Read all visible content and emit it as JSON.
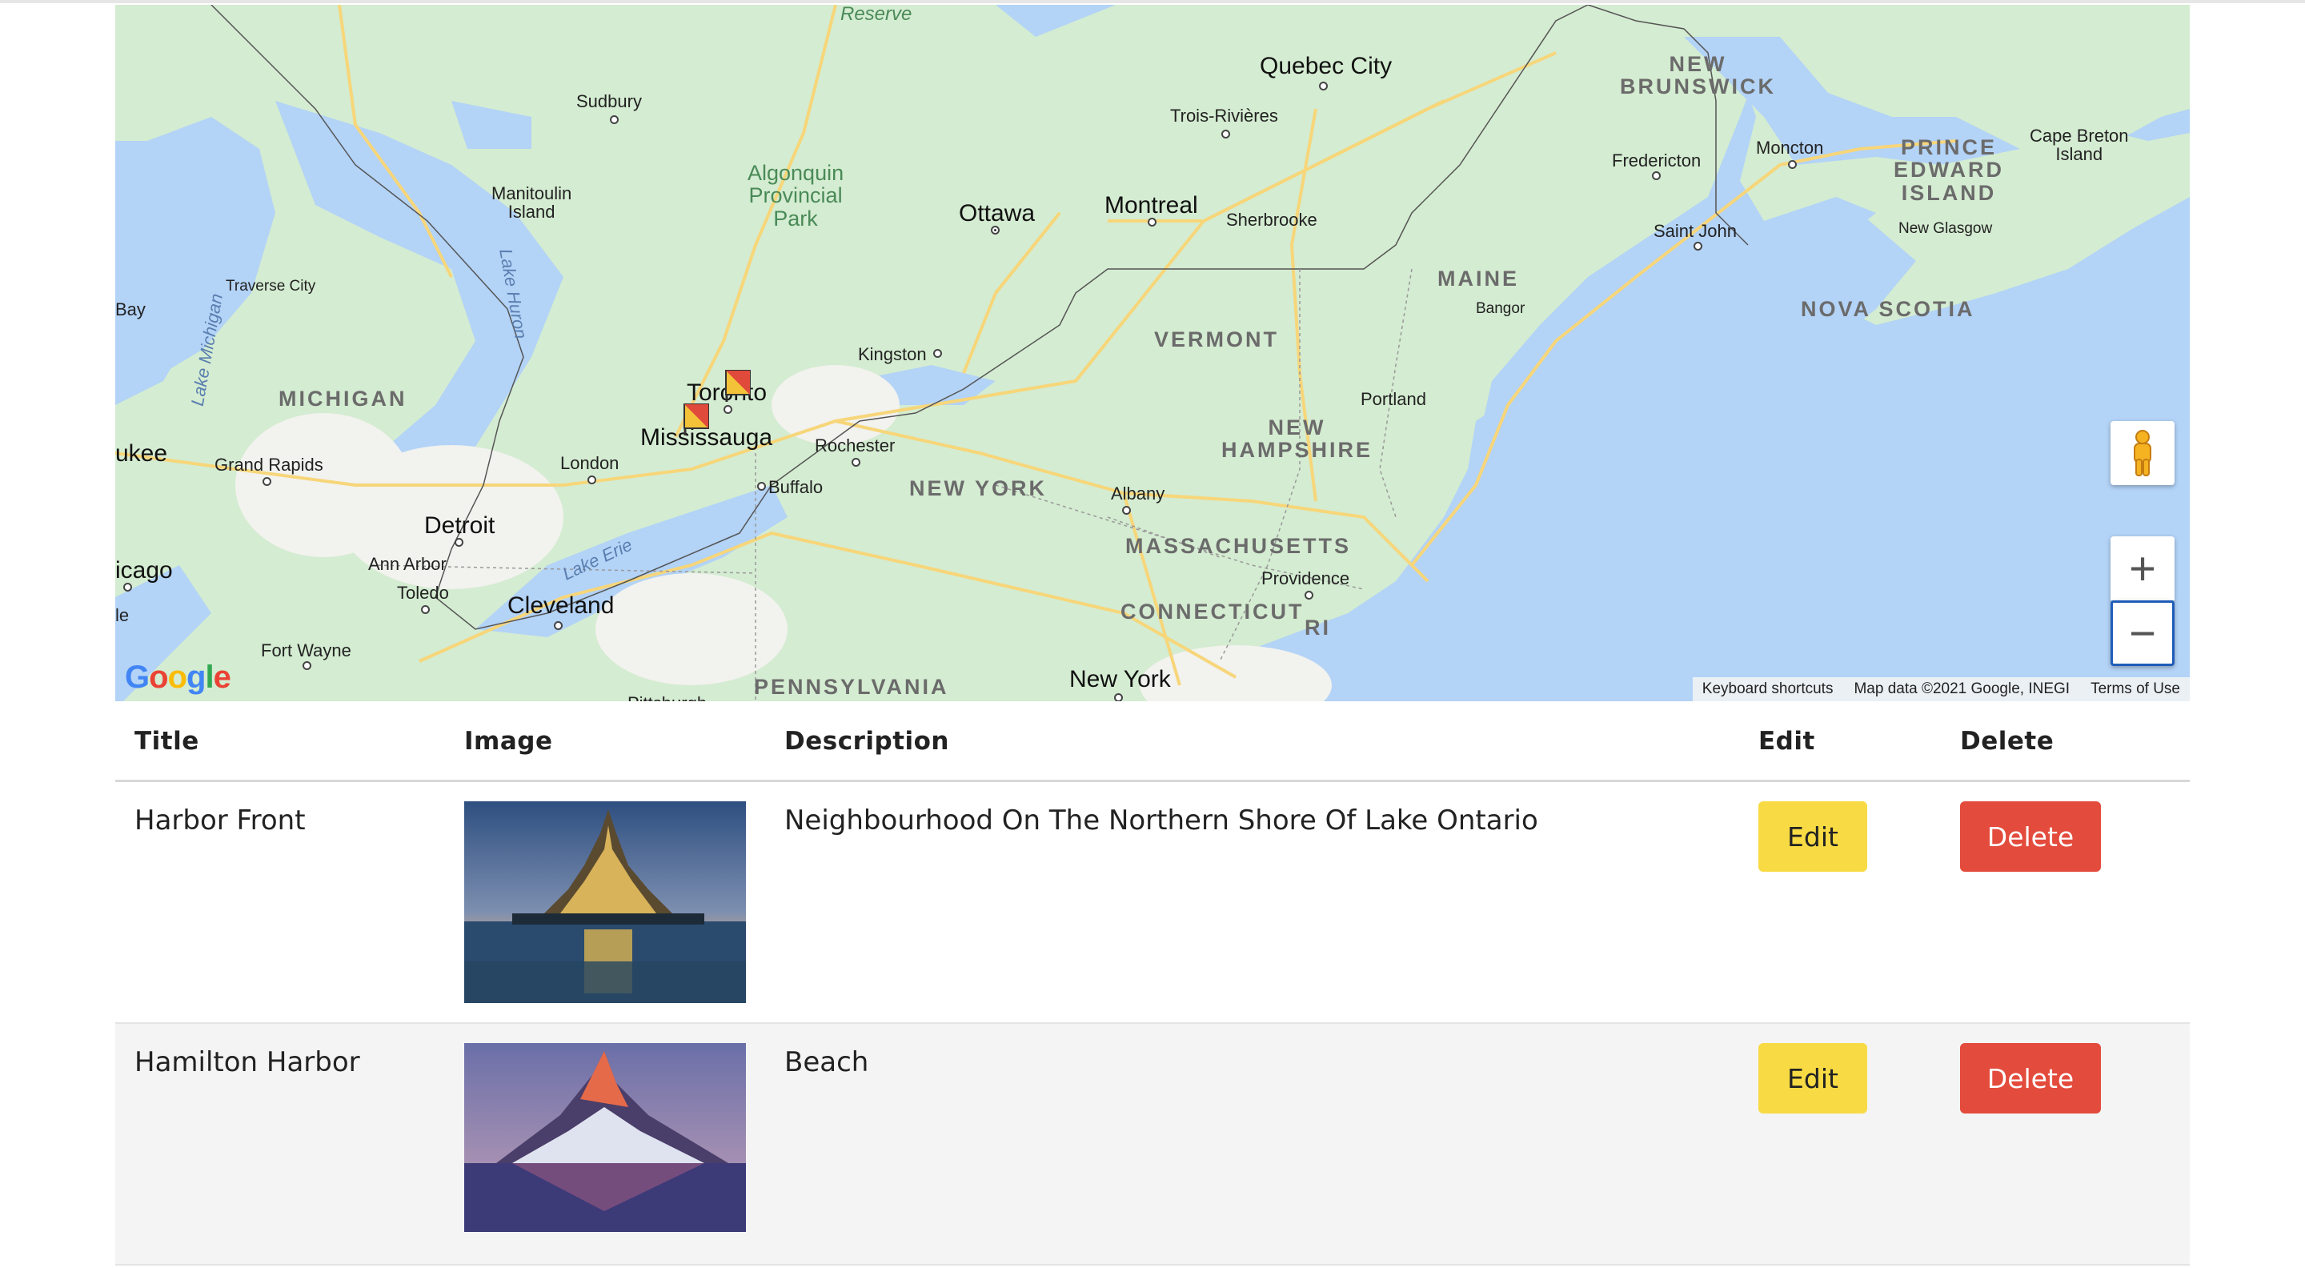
{
  "map": {
    "labels": {
      "reserve": "Reserve",
      "sudbury": "Sudbury",
      "quebec_city": "Quebec City",
      "trois_rivieres": "Trois-Rivières",
      "new_brunswick": "NEW\nBRUNSWICK",
      "fredericton": "Fredericton",
      "moncton": "Moncton",
      "pei": "PRINCE\nEDWARD\nISLAND",
      "cape_breton": "Cape Breton\nIsland",
      "new_glasgow": "New Glasgow",
      "saint_john": "Saint John",
      "manitoulin": "Manitoulin\nIsland",
      "algonquin": "Algonquin\nProvincial\nPark",
      "ottawa": "Ottawa",
      "montreal": "Montreal",
      "sherbrooke": "Sherbrooke",
      "maine": "MAINE",
      "bangor": "Bangor",
      "nova_scotia": "NOVA SCOTIA",
      "traverse_city": "Traverse City",
      "lake_huron": "Lake Huron",
      "bay": "Bay",
      "lake_michigan": "Lake Michigan",
      "michigan": "MICHIGAN",
      "kingston": "Kingston",
      "toronto": "Toronto",
      "vermont": "VERMONT",
      "portland": "Portland",
      "mississauga": "Mississauga",
      "rochester": "Rochester",
      "ukee": "ukee",
      "grand_rapids": "Grand Rapids",
      "london": "London",
      "buffalo": "Buffalo",
      "new_york_state": "NEW YORK",
      "new_hampshire": "NEW\nHAMPSHIRE",
      "albany": "Albany",
      "detroit": "Detroit",
      "massachusetts": "MASSACHUSETTS",
      "icago": "icago",
      "ann_arbor": "Ann Arbor",
      "lake_erie": "Lake Erie",
      "providence": "Providence",
      "toledo": "Toledo",
      "cleveland": "Cleveland",
      "le": "le",
      "connecticut": "CONNECTICUT",
      "ri": "RI",
      "fort_wayne": "Fort Wayne",
      "pennsylvania": "PENNSYLVANIA",
      "new_york_city": "New York",
      "pittsburgh": "Pittsburgh"
    },
    "google_logo": "Google",
    "attribution": {
      "shortcuts": "Keyboard shortcuts",
      "data": "Map data ©2021 Google, INEGI",
      "terms": "Terms of Use"
    },
    "controls": {
      "zoom_in": "+",
      "zoom_out": "−"
    },
    "colors": {
      "water": "#b3d3f7",
      "land": "#d4ecd1",
      "urban": "#f2f2ee",
      "road": "#f7d67a"
    }
  },
  "table": {
    "headers": {
      "title": "Title",
      "image": "Image",
      "description": "Description",
      "edit": "Edit",
      "delete": "Delete"
    },
    "rows": [
      {
        "title": "Harbor Front",
        "image": "castle-on-island-night-photo",
        "description": "Neighbourhood On The Northern Shore Of Lake Ontario",
        "edit_label": "Edit",
        "delete_label": "Delete"
      },
      {
        "title": "Hamilton Harbor",
        "image": "matterhorn-mountain-reflection-photo",
        "description": "Beach",
        "edit_label": "Edit",
        "delete_label": "Delete"
      }
    ],
    "colors": {
      "edit": "#f8db44",
      "delete": "#e34b3c"
    }
  }
}
